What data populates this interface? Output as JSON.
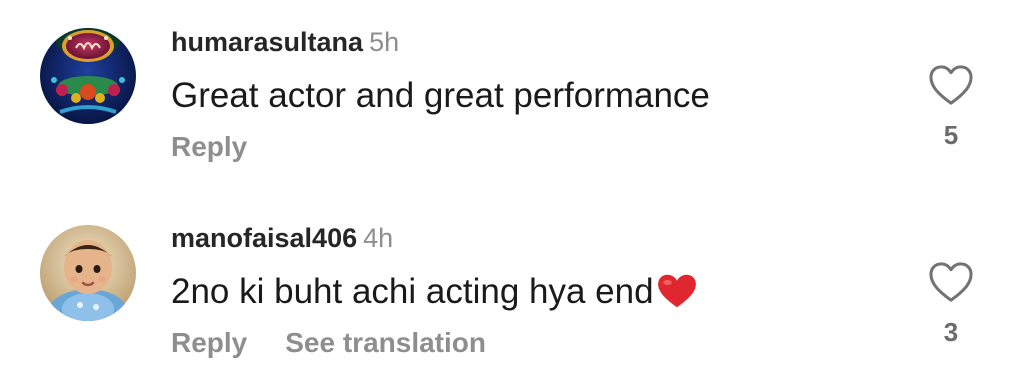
{
  "comments": [
    {
      "username": "humarasultana",
      "time": "5h",
      "text": "Great actor and great performance",
      "reply_label": "Reply",
      "like_count": "5",
      "avatar": "avatar-islamic-calligraphy"
    },
    {
      "username": "manofaisal406",
      "time": "4h",
      "text": "2no ki buht achi acting hya end",
      "emoji": "red-heart",
      "reply_label": "Reply",
      "translate_label": "See translation",
      "like_count": "3",
      "avatar": "avatar-baby-photo"
    }
  ],
  "colors": {
    "username": "#262626",
    "secondary": "#8e8e8e",
    "heart_emoji": "#e0262e"
  }
}
